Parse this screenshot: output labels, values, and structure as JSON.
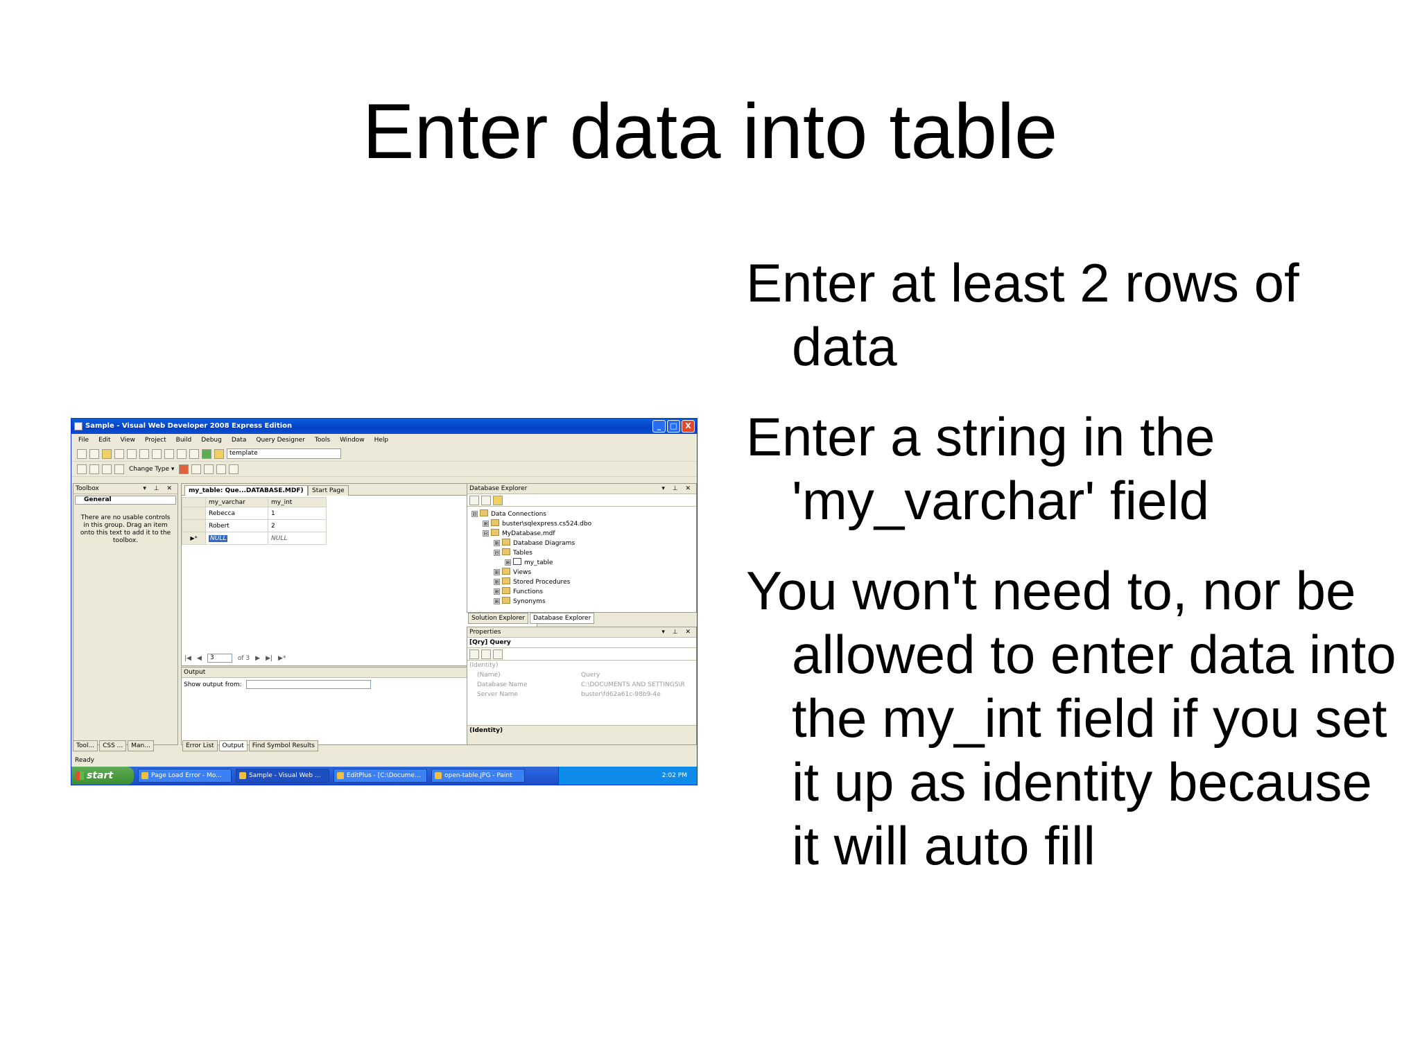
{
  "slide": {
    "title": "Enter data into table",
    "bullets": [
      "Enter at least 2 rows of data",
      "Enter a string in the 'my_varchar' field",
      "You won't need to, nor be allowed to enter data into the my_int field if you set it up as identity because it will auto fill"
    ]
  },
  "app": {
    "window_title": "Sample - Visual Web Developer 2008 Express Edition",
    "window_buttons": [
      "_",
      "□",
      "X"
    ],
    "menu": [
      "File",
      "Edit",
      "View",
      "Project",
      "Build",
      "Debug",
      "Data",
      "Query Designer",
      "Tools",
      "Window",
      "Help"
    ],
    "toolbar": {
      "template_combo": "template",
      "change_type": "Change Type ▾"
    },
    "toolbox": {
      "title": "Toolbox",
      "group": "General",
      "empty_text": "There are no usable controls in this group. Drag an item onto this text to add it to the toolbox."
    },
    "document": {
      "tabs": [
        "my_table: Que...DATABASE.MDF)",
        "Start Page"
      ],
      "columns": [
        "my_varchar",
        "my_int"
      ],
      "rows": [
        {
          "marker": "",
          "my_varchar": "Rebecca",
          "my_int": "1"
        },
        {
          "marker": "",
          "my_varchar": "Robert",
          "my_int": "2"
        },
        {
          "marker": "▶*",
          "my_varchar": "NULL",
          "my_int": "NULL"
        }
      ],
      "nav": {
        "current": "3",
        "of": "of 3"
      }
    },
    "output": {
      "title": "Output",
      "show_from": "Show output from:"
    },
    "database_explorer": {
      "title": "Database Explorer",
      "nodes": [
        {
          "label": "Data Connections",
          "indent": 0,
          "exp": "⊟"
        },
        {
          "label": "buster\\sqlexpress.cs524.dbo",
          "indent": 1,
          "exp": "⊞"
        },
        {
          "label": "MyDatabase.mdf",
          "indent": 1,
          "exp": "⊟"
        },
        {
          "label": "Database Diagrams",
          "indent": 2,
          "exp": "⊞"
        },
        {
          "label": "Tables",
          "indent": 2,
          "exp": "⊟"
        },
        {
          "label": "my_table",
          "indent": 3,
          "exp": "⊞"
        },
        {
          "label": "Views",
          "indent": 2,
          "exp": "⊞"
        },
        {
          "label": "Stored Procedures",
          "indent": 2,
          "exp": "⊞"
        },
        {
          "label": "Functions",
          "indent": 2,
          "exp": "⊞"
        },
        {
          "label": "Synonyms",
          "indent": 2,
          "exp": "⊞"
        }
      ],
      "tabs": [
        "Solution Explorer",
        "Database Explorer"
      ]
    },
    "properties": {
      "title": "Properties",
      "object": "[Qry] Query",
      "group": "(Identity)",
      "rows": [
        {
          "name": "(Name)",
          "value": "Query"
        },
        {
          "name": "Database Name",
          "value": "C:\\DOCUMENTS AND SETTINGS\\REI"
        },
        {
          "name": "Server Name",
          "value": "buster\\fd62a61c-98b9-4e"
        }
      ],
      "description": "(Identity)"
    },
    "bottom_tabs_left": [
      "Tool...",
      "CSS ...",
      "Man..."
    ],
    "bottom_tabs_mid": [
      "Error List",
      "Output",
      "Find Symbol Results"
    ],
    "status": "Ready",
    "taskbar": {
      "start": "start",
      "tasks": [
        "Page Load Error - Mo...",
        "Sample - Visual Web ...",
        "EditPlus - [C:\\Docume...",
        "open-table.JPG - Paint"
      ],
      "clock": "2:02 PM"
    }
  }
}
